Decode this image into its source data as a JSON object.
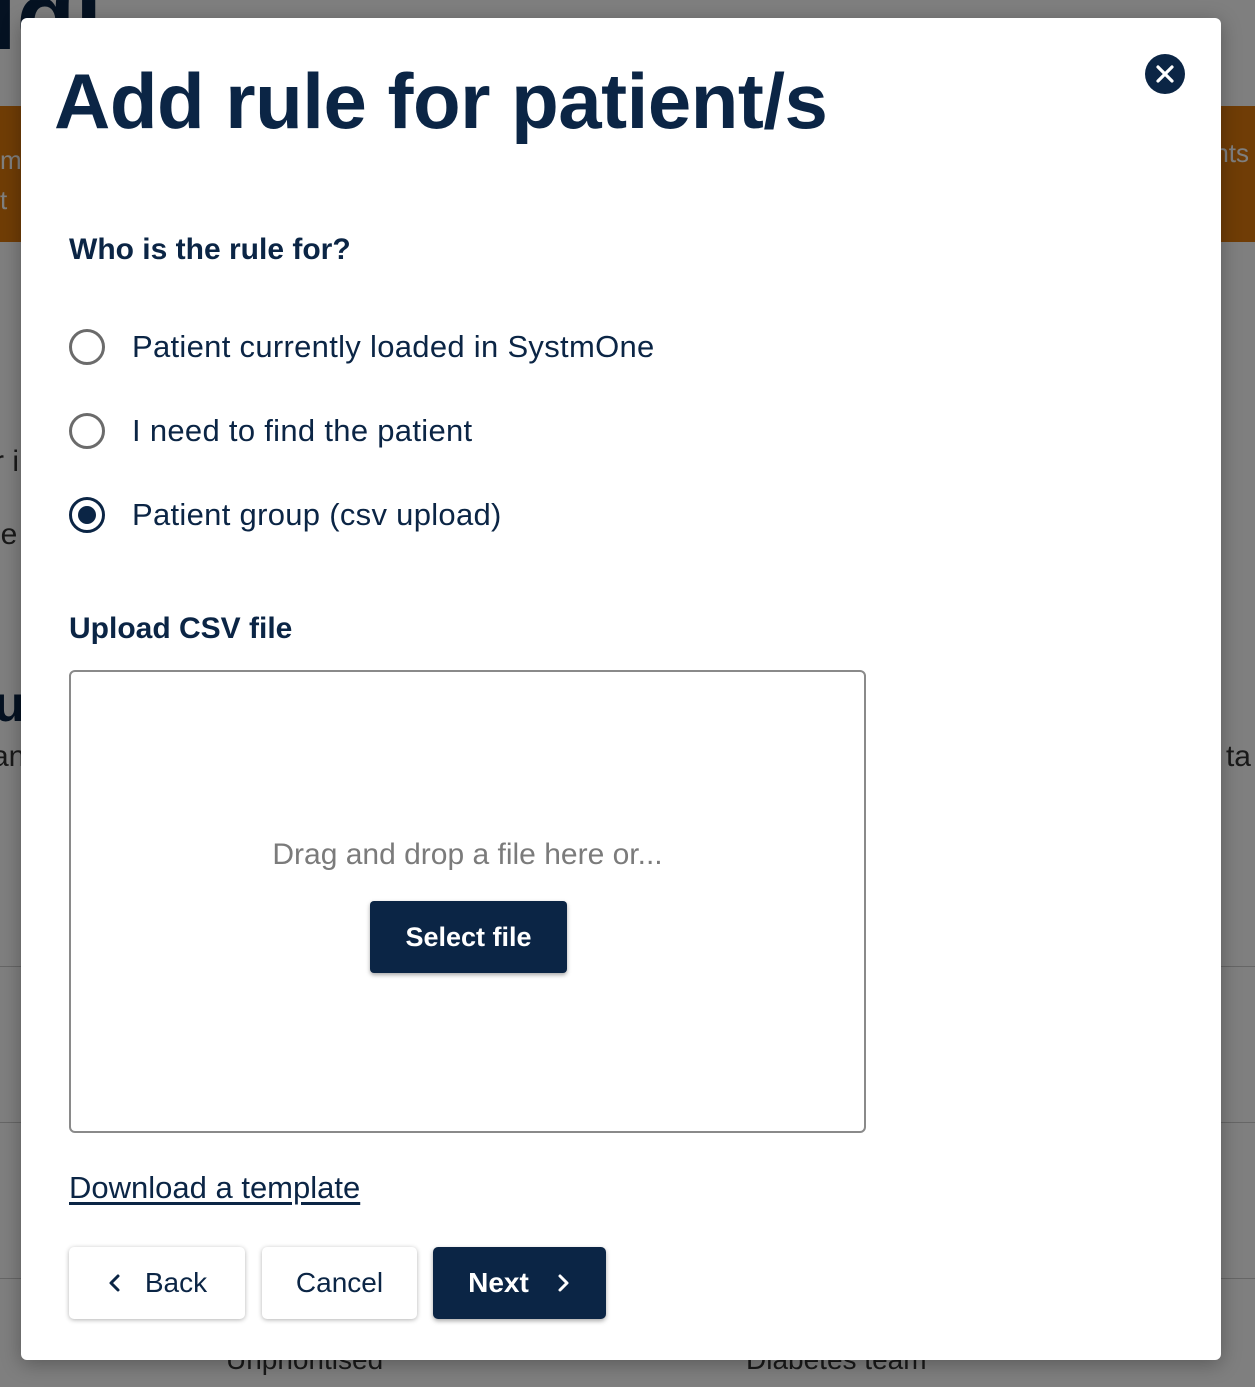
{
  "modal": {
    "title": "Add rule for patient/s",
    "close_icon": "close-icon"
  },
  "who": {
    "label": "Who is the rule for?",
    "options": [
      {
        "label": "Patient currently loaded in SystmOne",
        "selected": false
      },
      {
        "label": "I need to find the patient",
        "selected": false
      },
      {
        "label": "Patient group (csv upload)",
        "selected": true
      }
    ]
  },
  "upload": {
    "label": "Upload CSV file",
    "dropzone_text": "Drag and drop a file here or...",
    "select_file_label": "Select file"
  },
  "download_template_label": "Download a template",
  "footer": {
    "back_label": "Back",
    "cancel_label": "Cancel",
    "next_label": "Next"
  },
  "colors": {
    "brand_navy": "#0b2545",
    "banner_orange": "#e07a0c"
  },
  "background_fragments": {
    "title_fragment": "igi",
    "banner_left_1": "m",
    "banner_left_2": "t",
    "banner_right": "nts",
    "text_1": "r i",
    "text_2": "le",
    "heading": "u",
    "text_3": "an",
    "text_4": "ta",
    "bottom_1": "Unprioritised",
    "bottom_2": "Diabetes team"
  }
}
